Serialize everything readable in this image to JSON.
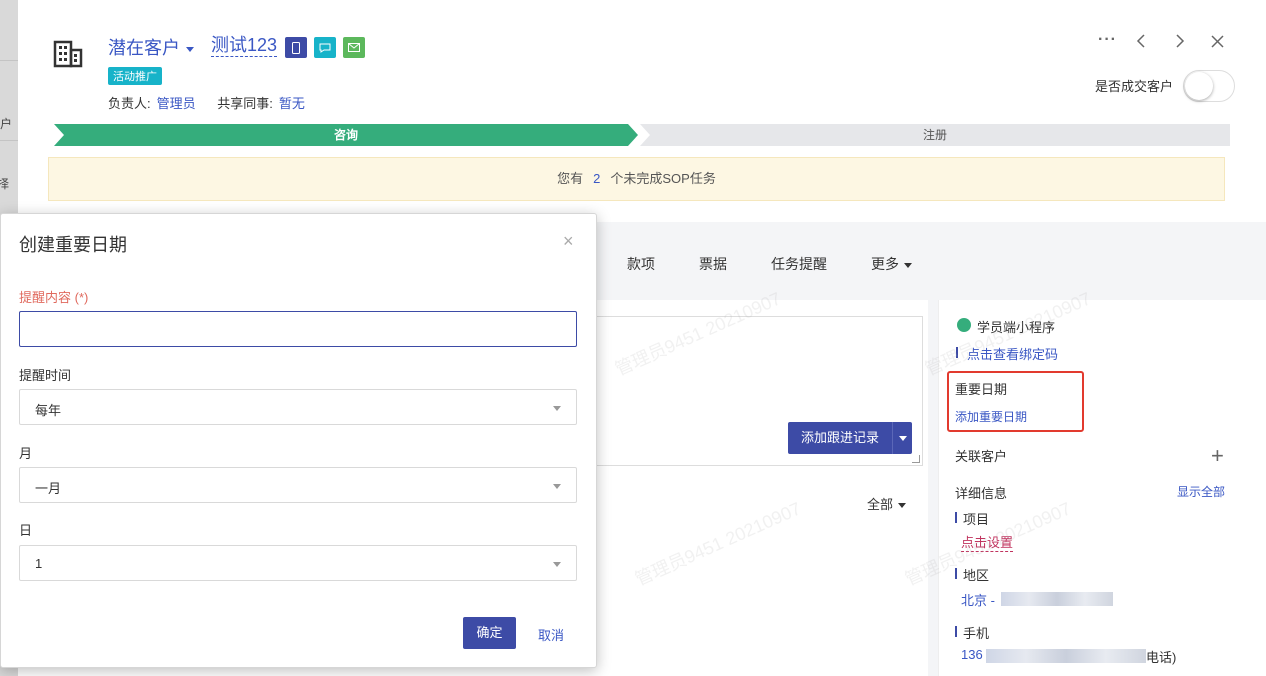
{
  "background": {
    "col1": "户",
    "col2": "择"
  },
  "customer": {
    "type": "潜在客户",
    "name": "测试123",
    "tag": "活动推广",
    "owner_label": "负责人:",
    "owner": "管理员",
    "share_label": "共享同事:",
    "share": "暂无",
    "deal_switch_label": "是否成交客户"
  },
  "header_icons": [
    "building-icon",
    "phone-icon",
    "chat-icon",
    "mail-icon",
    "more-icon",
    "prev-icon",
    "next-icon",
    "close-icon"
  ],
  "stages": [
    {
      "label": "咨询",
      "active": true
    },
    {
      "label": "注册",
      "active": false
    }
  ],
  "sop": {
    "prefix": "您有",
    "count": "2",
    "suffix": "个未完成SOP任务"
  },
  "tabs": [
    "款项",
    "票据",
    "任务提醒",
    "更多"
  ],
  "followup": {
    "add_label": "添加跟进记录",
    "filter": "全部"
  },
  "side": {
    "mini_program": "学员端小程序",
    "bind_code": "点击查看绑定码",
    "important_date_title": "重要日期",
    "add_important_date": "添加重要日期",
    "related_customer": "关联客户",
    "detail_info": "详细信息",
    "show_all": "显示全部",
    "project_label": "项目",
    "project_value": "点击设置",
    "region_label": "地区",
    "region_value": "北京 -",
    "phone_label": "手机",
    "phone_value": "136",
    "phone_suffix": "电话)"
  },
  "watermark": "管理员9451 20210907",
  "modal": {
    "title": "创建重要日期",
    "content_label": "提醒内容 (*)",
    "content_value": "",
    "time_label": "提醒时间",
    "time_value": "每年",
    "month_label": "月",
    "month_value": "一月",
    "day_label": "日",
    "day_value": "1",
    "ok": "确定",
    "cancel": "取消"
  },
  "colors": {
    "primary": "#3d4ba6",
    "link": "#3a57c4",
    "stage_active": "#35ad7c",
    "tag": "#17b3c9",
    "highlight": "#e23a2e"
  }
}
